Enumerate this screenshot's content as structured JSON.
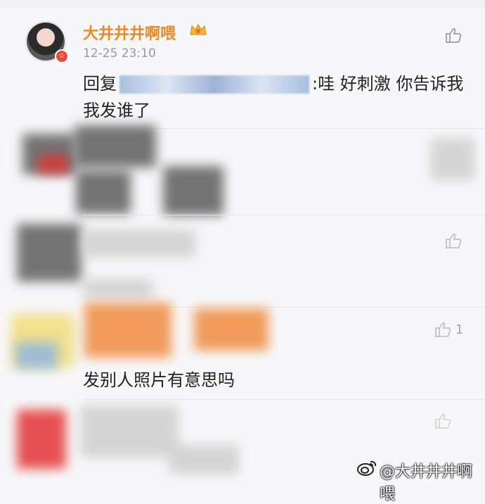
{
  "post": {
    "username": "大井井井啊喂",
    "timestamp": "12-25 23:10",
    "reply_prefix": "回复",
    "comment_rest": ":哇 好刺激 你告诉我我发谁了"
  },
  "comments": [
    {
      "like_count": "1"
    }
  ],
  "reply": {
    "text": "发别人照片有意思吗"
  },
  "watermark": {
    "text": "@大井井井啊喂"
  }
}
